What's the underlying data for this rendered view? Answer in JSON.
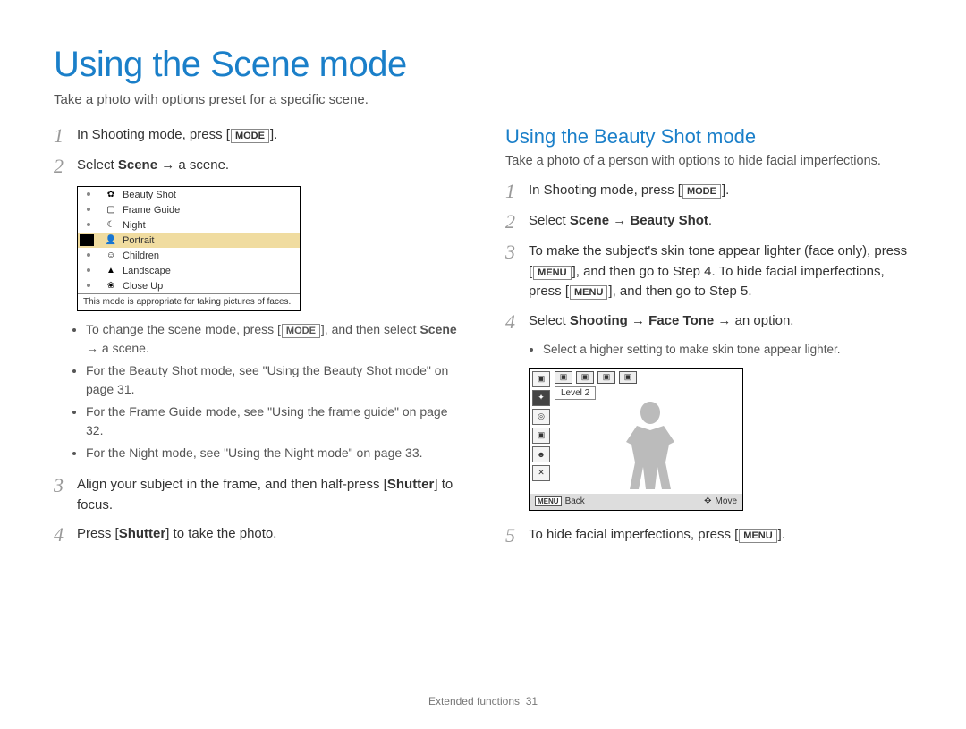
{
  "title": "Using the Scene mode",
  "subtitle": "Take a photo with options preset for a specific scene.",
  "left": {
    "step1": {
      "num": "1",
      "pre": "In Shooting mode, press [",
      "btn": "MODE",
      "post": "]."
    },
    "step2": {
      "num": "2",
      "text_pre": "Select ",
      "bold": "Scene",
      "text_post": " → a scene."
    },
    "bullets": [
      {
        "pre": "To change the scene mode, press [",
        "btn": "MODE",
        "mid": "], and then select ",
        "bold": "Scene",
        "post": " → a scene."
      },
      {
        "text": "For the Beauty Shot mode, see \"Using the Beauty Shot mode\" on page 31."
      },
      {
        "text": "For the Frame Guide mode, see \"Using the frame guide\" on page 32."
      },
      {
        "text": "For the Night mode, see \"Using the Night mode\" on page 33."
      }
    ],
    "step3": {
      "num": "3",
      "pre": "Align your subject in the frame, and then half-press [",
      "bold": "Shutter",
      "post": "] to focus."
    },
    "step4": {
      "num": "4",
      "pre": "Press [",
      "bold": "Shutter",
      "post": "] to take the photo."
    }
  },
  "scene_menu": {
    "items": [
      {
        "icon": "✿",
        "label": "Beauty Shot"
      },
      {
        "icon": "▢",
        "label": "Frame Guide"
      },
      {
        "icon": "☾",
        "label": "Night"
      },
      {
        "icon": "👤",
        "label": "Portrait",
        "selected": true
      },
      {
        "icon": "☺",
        "label": "Children"
      },
      {
        "icon": "▲",
        "label": "Landscape"
      },
      {
        "icon": "❀",
        "label": "Close Up"
      }
    ],
    "desc": "This mode is appropriate for taking pictures of faces."
  },
  "right": {
    "section_title": "Using the Beauty Shot mode",
    "section_sub": "Take a photo of a person with options to hide facial imperfections.",
    "step1": {
      "num": "1",
      "pre": "In Shooting mode, press [",
      "btn": "MODE",
      "post": "]."
    },
    "step2": {
      "num": "2",
      "pre": "Select ",
      "bold": "Scene → Beauty Shot",
      "post": "."
    },
    "step3": {
      "num": "3",
      "pre": "To make the subject's skin tone appear lighter (face only), press [",
      "btn1": "MENU",
      "mid": "], and then go to Step 4. To hide facial imperfections, press [",
      "btn2": "MENU",
      "post": "], and then go to Step 5."
    },
    "step4": {
      "num": "4",
      "pre": "Select ",
      "bold": "Shooting → Face Tone",
      "post": " → an option."
    },
    "step4_sub": "Select a higher setting to make skin tone appear lighter.",
    "step5": {
      "num": "5",
      "pre": "To hide facial imperfections, press [",
      "btn": "MENU",
      "post": "]."
    }
  },
  "facetone_shot": {
    "level": "Level 2",
    "back_key": "MENU",
    "back_label": "Back",
    "move_icon": "✥",
    "move_label": "Move"
  },
  "footer": {
    "label": "Extended functions",
    "page": "31"
  }
}
